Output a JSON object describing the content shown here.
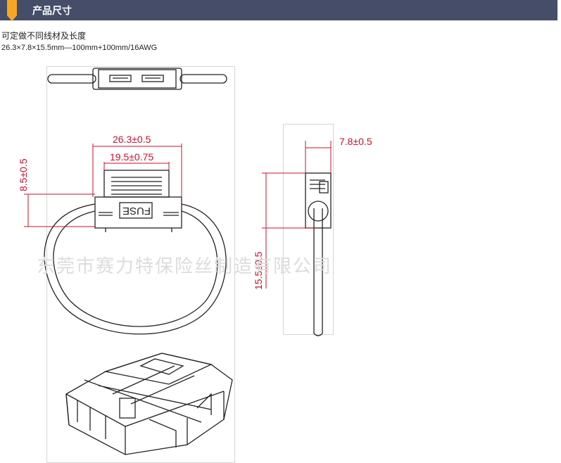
{
  "header": {
    "title": "产品尺寸"
  },
  "description": {
    "line1": "可定做不同线材及长度",
    "line2": "26.3×7.8×15.5mm—100mm+100mm/16AWG"
  },
  "dimensions": {
    "width_outer": "26.3±0.5",
    "width_inner": "19.5±0.75",
    "height_top": "8.5±0.5",
    "depth": "7.8±0.5",
    "height_side": "15.5±0.5"
  },
  "labels": {
    "fuse_text": "FUSE"
  },
  "watermark": "东莞市赛力特保险丝制造有限公司",
  "colors": {
    "header_bg": "#454d68",
    "accent": "#f5a623",
    "dimension": "#c8102e"
  }
}
